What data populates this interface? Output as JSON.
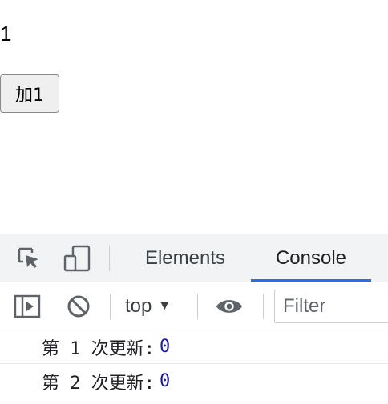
{
  "page": {
    "counter_value": "1",
    "add_button_label": "加1"
  },
  "devtools": {
    "tabs": [
      {
        "label": "Elements",
        "active": false
      },
      {
        "label": "Console",
        "active": true
      }
    ],
    "accent_color": "#1a73e8",
    "console_toolbar": {
      "context_label": "top",
      "context_arrow": "▼",
      "filter_placeholder": "Filter"
    },
    "icons": {
      "inspect": "inspect-element-icon",
      "device": "device-toolbar-icon",
      "sidebar": "show-console-sidebar-icon",
      "clear": "clear-console-icon",
      "eye": "live-expression-icon"
    },
    "console_logs": [
      {
        "text": "第 1 次更新:",
        "value": "0"
      },
      {
        "text": "第 2 次更新:",
        "value": "0"
      }
    ]
  }
}
